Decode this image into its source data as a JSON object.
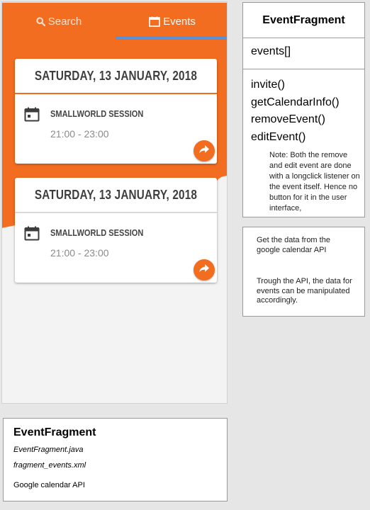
{
  "colors": {
    "accent_orange": "#f36d21",
    "tab_indicator_blue": "#5b8fd9",
    "card_background": "#ffffff",
    "page_background": "#e6e6e6"
  },
  "phone": {
    "tabs": [
      {
        "label": "Search",
        "icon": "search-icon"
      },
      {
        "label": "Events",
        "icon": "calendar-icon",
        "active": true
      }
    ],
    "events": [
      {
        "date": "SATURDAY, 13 JANUARY, 2018",
        "title": "SMALLWORLD SESSION",
        "time": "21:00 - 23:00",
        "icon": "calendar-icon",
        "action_icon": "share-icon"
      },
      {
        "date": "SATURDAY, 13 JANUARY, 2018",
        "title": "SMALLWORLD SESSION",
        "time": "21:00 - 23:00",
        "icon": "calendar-icon",
        "action_icon": "share-icon"
      }
    ]
  },
  "uml": {
    "class_name": "EventFragment",
    "attributes": [
      "events[]"
    ],
    "methods": [
      "invite()",
      "getCalendarInfo()",
      "removeEvent()",
      "editEvent()"
    ],
    "note": "Note: Both the remove and edit event are done with a longclick listener on the event itself. Hence no button for it in the user interface,"
  },
  "api_note": {
    "paragraph1": "Get the data from the google calendar API",
    "paragraph2": "Trough the API, the data for events can be manipulated accordingly."
  },
  "info": {
    "title": "EventFragment",
    "java_file": "EventFragment.java",
    "layout_file": "fragment_events.xml",
    "dependency": "Google calendar API"
  }
}
